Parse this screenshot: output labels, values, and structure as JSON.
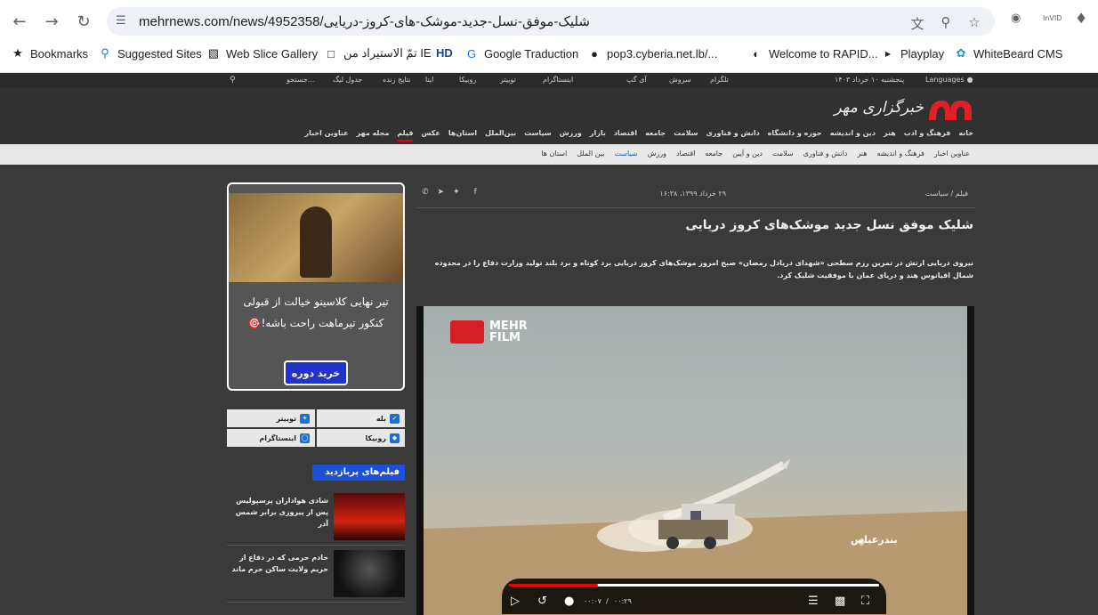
{
  "browser": {
    "url": "mehrnews.com/news/4952358/شلیک-موفق-نسل-جدید-موشک-های-کروز-دریایی",
    "bookmarks": [
      {
        "label": "Bookmarks",
        "icon": "star-icon"
      },
      {
        "label": "Suggested Sites",
        "icon": "search-icon"
      },
      {
        "label": "Web Slice Gallery",
        "icon": "slice-icon"
      },
      {
        "label": "تمّ الاستيراد من IE",
        "icon": "folder-icon"
      },
      {
        "label": "HD",
        "icon": "hd-icon"
      },
      {
        "label": "Google Traduction",
        "icon": "translate-icon"
      },
      {
        "label": "pop3.cyberia.net.lb/...",
        "icon": "globe-icon"
      },
      {
        "label": "Welcome to RAPID...",
        "icon": "rapid-icon"
      },
      {
        "label": "Playplay",
        "icon": "playplay-icon"
      },
      {
        "label": "WhiteBeard CMS",
        "icon": "whitebeard-icon"
      }
    ],
    "ext_label": "InVID"
  },
  "site": {
    "top_bar": {
      "languages": "Languages",
      "date": "پنجشنبه ۱۰ خرداد ۱۴۰۳",
      "links": [
        "تلگرام",
        "سروش",
        "آی گپ",
        "اینستاگرام",
        "توییتر",
        "روبیکا",
        "ایتا",
        "نتایج زنده",
        "جدول لیگ"
      ],
      "search_placeholder": "جستجو..."
    },
    "logo_text": "خبرگزاری مهر",
    "main_nav": [
      "خانه",
      "فرهنگ و ادب",
      "هنر",
      "دین و اندیشه",
      "حوزه و دانشگاه",
      "دانش و فناوری",
      "سلامت",
      "جامعه",
      "اقتصاد",
      "بازار",
      "ورزش",
      "سیاست",
      "بین‌الملل",
      "استان‌ها",
      "عکس",
      "فیلم",
      "مجله مهر",
      "عناوین اخبار"
    ],
    "main_nav_active": "فیلم",
    "sub_nav": [
      "عناوین اخبار",
      "فرهنگ و اندیشه",
      "هنر",
      "دانش و فناوری",
      "سلامت",
      "دین و آیین",
      "جامعه",
      "اقتصاد",
      "ورزش",
      "سیاست",
      "بین الملل",
      "استان ها"
    ],
    "sub_nav_active": "سیاست"
  },
  "article": {
    "breadcrumb": "فیلم / سیاست",
    "date": "۲۹ خرداد ۱۳۹۹، ۱۶:۳۸",
    "title": "شلیک موفق نسل جدید موشک‌های کروز دریایی",
    "lead": "نیروی دریایی ارتش در تمرین رزم سطحی «شهدای دریادل رمضان» صبح امروز موشک‌های کروز دریایی برد کوتاه و برد بلند تولید وزارت دفاع را در محدوده شمال اقیانوس هند و دریای عمان با موفقیت شلیک کرد.",
    "share_icons": [
      "whatsapp-icon",
      "telegram-icon",
      "twitter-icon",
      "facebook-icon"
    ]
  },
  "video": {
    "logo_line1": "MEHR",
    "logo_line2": "FILM",
    "location_caption": "بندرعباس",
    "current_time": "۰۰:۰۷",
    "duration": "۰۰:۲۹",
    "progress": 0.24
  },
  "sidebar": {
    "ad_text": "تیر نهایی کلاسینو خیالت از قبولی کنکور تیرماهت راحت باشه!🎯",
    "ad_cta": "خرید دوره",
    "social": [
      {
        "label": "بله",
        "icon": "bale-icon"
      },
      {
        "label": "توییتر",
        "icon": "twitter-icon"
      },
      {
        "label": "روبیکا",
        "icon": "rubika-icon"
      },
      {
        "label": "اینستاگرام",
        "icon": "instagram-icon"
      }
    ],
    "popular_title": "فیلم‌های پربازدید",
    "popular": [
      {
        "text": "شادی هواداران پرسپولیس پس از پیروزی برابر شمس آذر"
      },
      {
        "text": "خادم حرمی که در دفاع از حریم ولایت ساکن حرم ماند"
      }
    ]
  }
}
